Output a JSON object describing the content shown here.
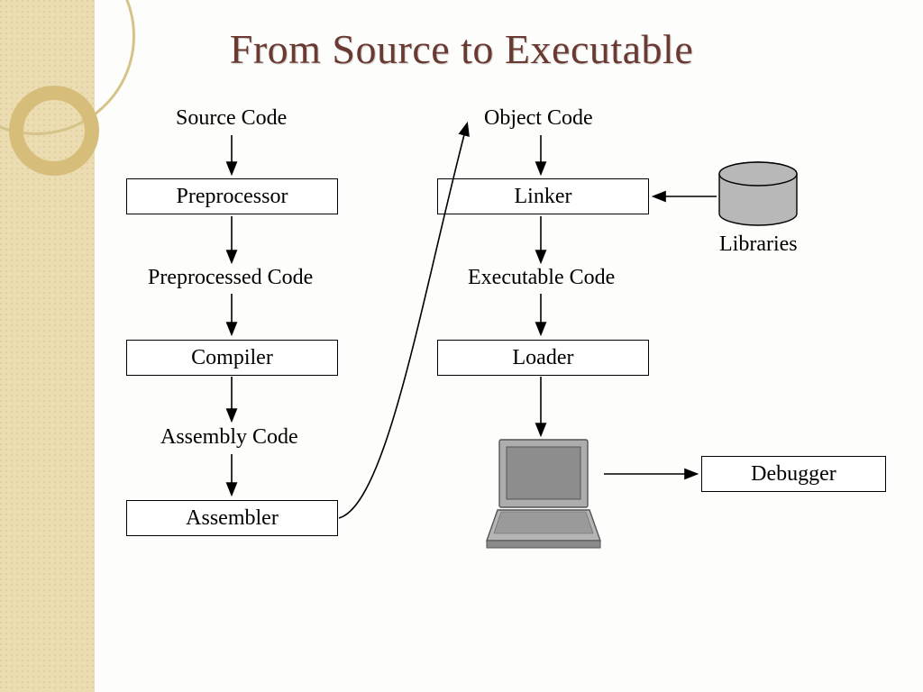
{
  "title": "From Source to Executable",
  "left_column": {
    "source_code": "Source Code",
    "preprocessor": "Preprocessor",
    "preprocessed_code": "Preprocessed Code",
    "compiler": "Compiler",
    "assembly_code": "Assembly Code",
    "assembler": "Assembler"
  },
  "right_column": {
    "object_code": "Object Code",
    "linker": "Linker",
    "executable_code": "Executable Code",
    "loader": "Loader"
  },
  "libraries": "Libraries",
  "debugger": "Debugger",
  "flow": [
    "Source Code",
    "Preprocessor",
    "Preprocessed Code",
    "Compiler",
    "Assembly Code",
    "Assembler",
    "Object Code",
    "Linker",
    "Executable Code",
    "Loader",
    "Computer"
  ],
  "side_inputs": {
    "linker_input": "Libraries",
    "computer_output": "Debugger"
  }
}
